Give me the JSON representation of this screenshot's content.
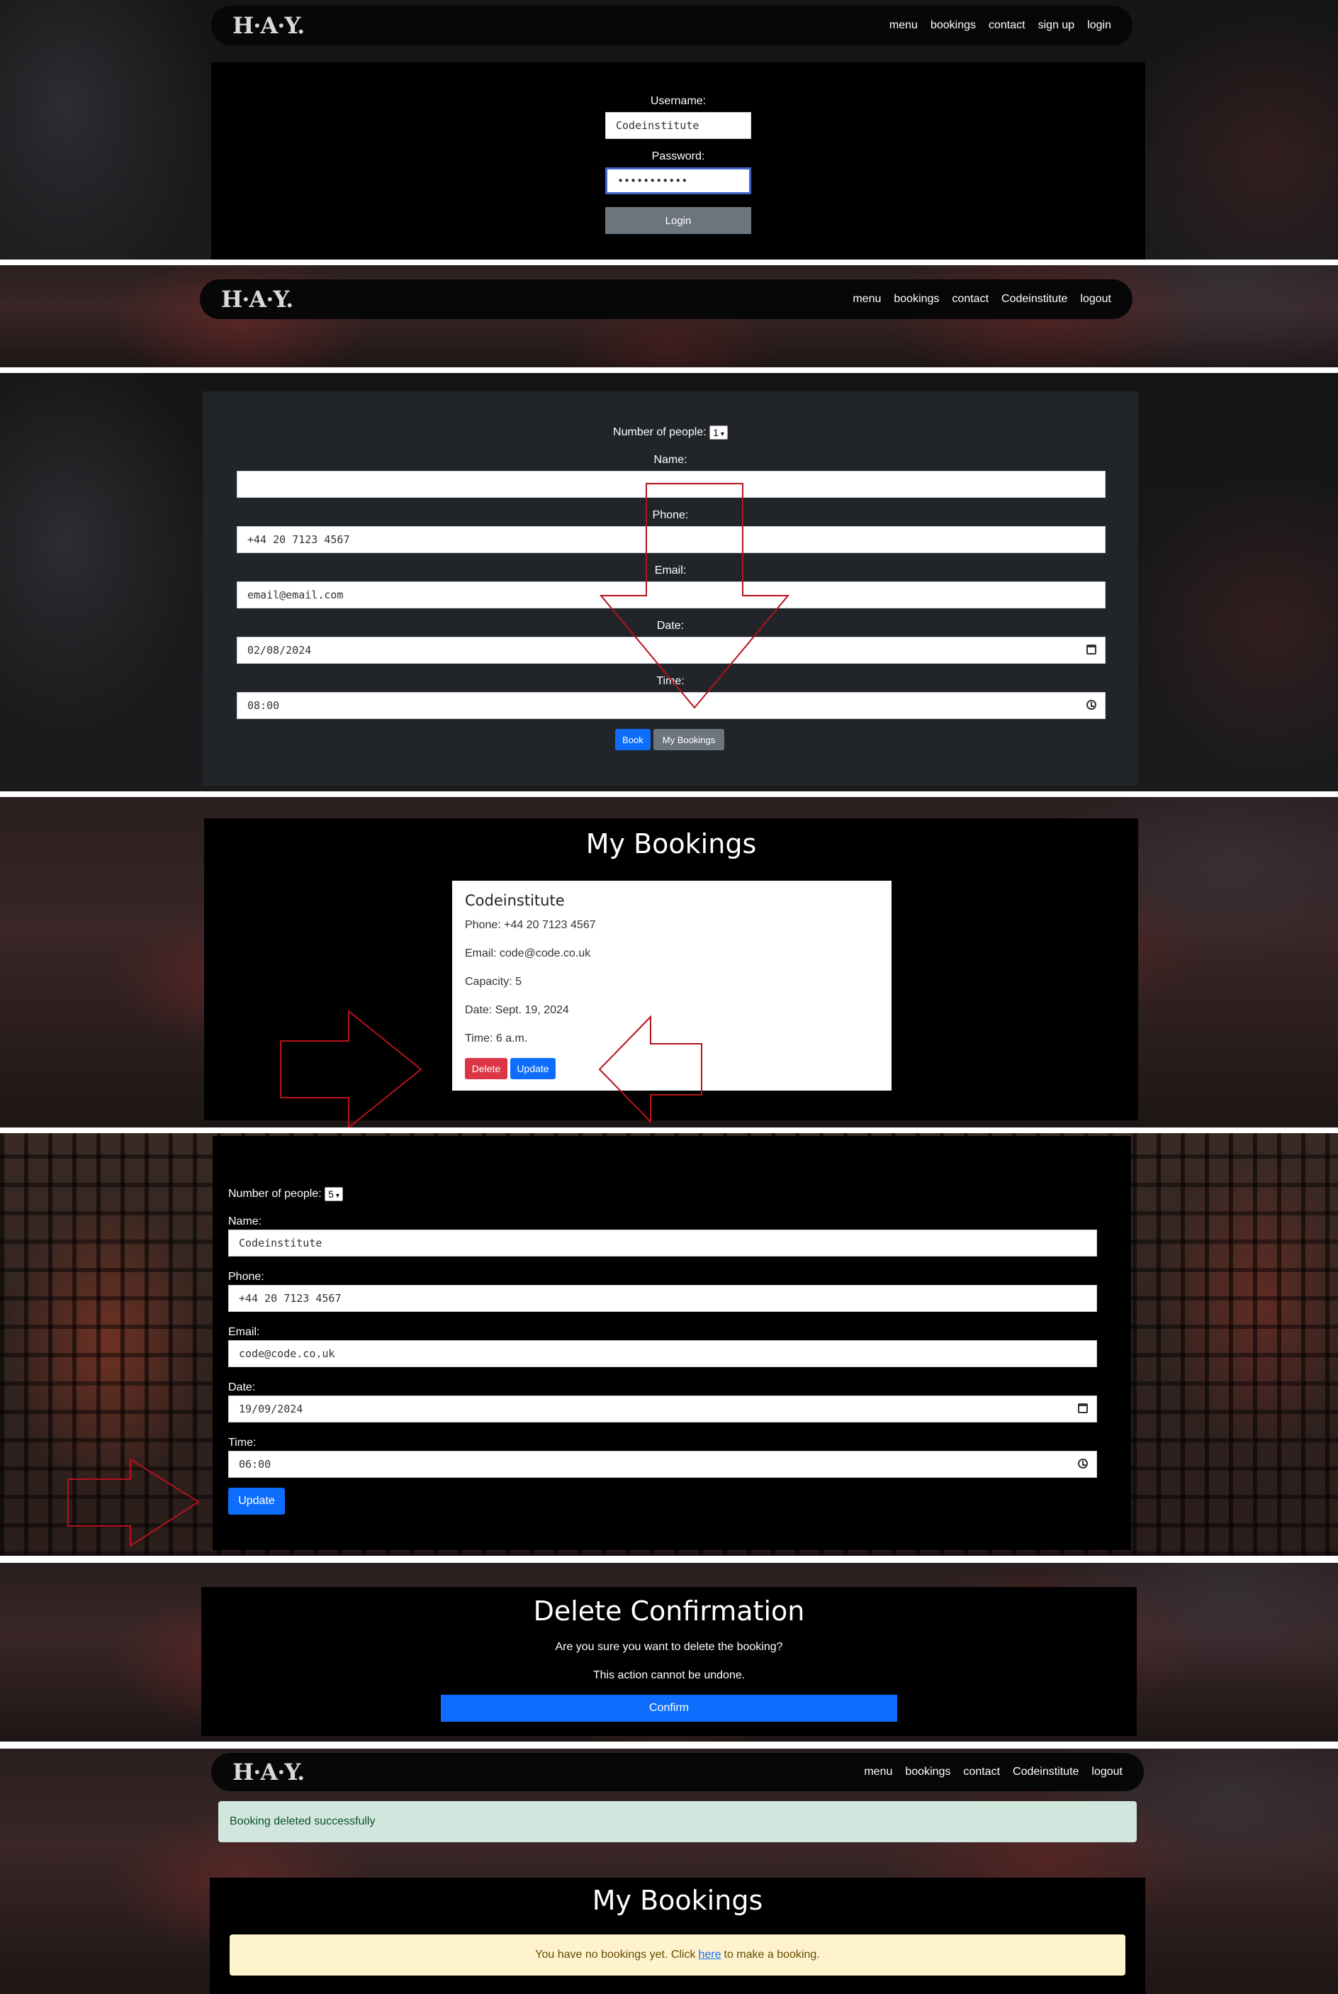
{
  "brand": {
    "logo": "H·A·Y."
  },
  "nav_logged_out": [
    "menu",
    "bookings",
    "contact",
    "sign up",
    "login"
  ],
  "nav_logged_in": [
    "menu",
    "bookings",
    "contact",
    "Codeinstitute",
    "logout"
  ],
  "login": {
    "username_label": "Username:",
    "username_value": "Codeinstitute",
    "password_label": "Password:",
    "password_value": "•••••••••••",
    "login_button": "Login"
  },
  "booking_form": {
    "people_label": "Number of people:",
    "people_value": "1",
    "name_label": "Name:",
    "name_value": "",
    "phone_label": "Phone:",
    "phone_value": "+44 20 7123 4567",
    "email_label": "Email:",
    "email_value": "email@email.com",
    "date_label": "Date:",
    "date_value": "02/08/2024",
    "time_label": "Time:",
    "time_value": "08:00",
    "book_button": "Book",
    "mybookings_button": "My Bookings"
  },
  "my_bookings": {
    "title": "My Bookings",
    "name": "Codeinstitute",
    "phone": "Phone: +44 20 7123 4567",
    "email": "Email: code@code.co.uk",
    "capacity": "Capacity: 5",
    "date": "Date: Sept. 19, 2024",
    "time": "Time: 6 a.m.",
    "delete_button": "Delete",
    "update_button": "Update"
  },
  "update_form": {
    "people_label": "Number of people:",
    "people_value": "5",
    "name_label": "Name:",
    "name_value": "Codeinstitute",
    "phone_label": "Phone:",
    "phone_value": "+44 20 7123 4567",
    "email_label": "Email:",
    "email_value": "code@code.co.uk",
    "date_label": "Date:",
    "date_value": "19/09/2024",
    "time_label": "Time:",
    "time_value": "06:00",
    "update_button": "Update"
  },
  "delete_confirm": {
    "title": "Delete Confirmation",
    "question": "Are you sure you want to delete the booking?",
    "warning": "This action cannot be undone.",
    "confirm_button": "Confirm"
  },
  "after_delete": {
    "alert": "Booking deleted successfully",
    "title": "My Bookings",
    "empty_prefix": "You have no bookings yet. Click",
    "empty_link": "here",
    "empty_suffix": "to make a booking."
  },
  "colors": {
    "primary": "#0d6efd",
    "secondary": "#6c757d",
    "danger": "#dc3545",
    "success_bg": "#d1e7dd",
    "warning_bg": "#fff3cd",
    "annotation_arrow": "#b5121b"
  }
}
